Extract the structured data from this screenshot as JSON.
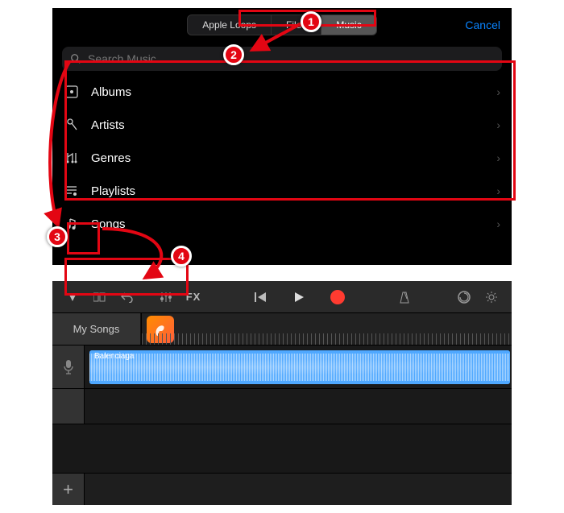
{
  "tabs": {
    "loops": "Apple Loops",
    "files": "Files",
    "music": "Music"
  },
  "cancel": "Cancel",
  "search": {
    "placeholder": "Search Music"
  },
  "browse": [
    {
      "icon": "album-icon",
      "label": "Albums"
    },
    {
      "icon": "mic-icon",
      "label": "Artists"
    },
    {
      "icon": "genre-icon",
      "label": "Genres"
    },
    {
      "icon": "playlist-icon",
      "label": "Playlists"
    },
    {
      "icon": "note-icon",
      "label": "Songs"
    }
  ],
  "mysongs": "My Songs",
  "fx_label": "FX",
  "track": {
    "region_name": "Balenciaga"
  },
  "callouts": {
    "c1": "1",
    "c2": "2",
    "c3": "3",
    "c4": "4"
  }
}
